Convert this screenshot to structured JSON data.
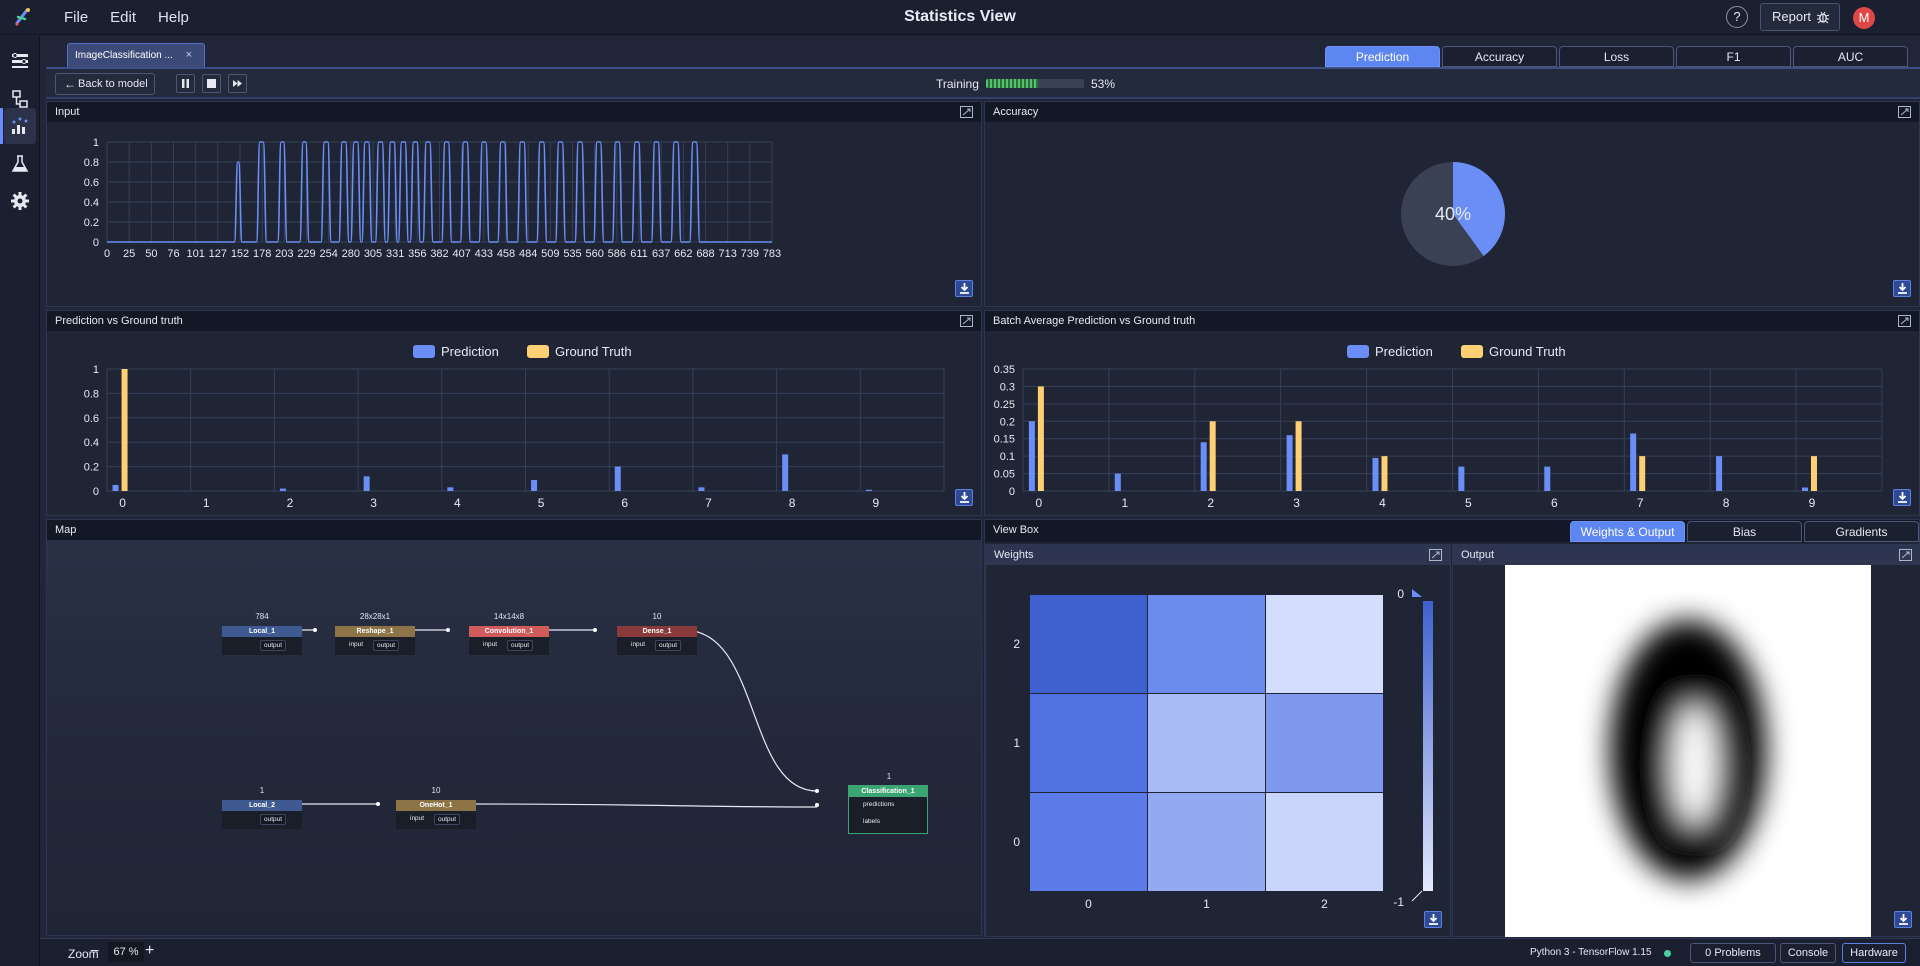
{
  "app": {
    "title": "Statistics View",
    "menu": [
      "File",
      "Edit",
      "Help"
    ],
    "help_label": "?",
    "report_label": "Report",
    "avatar_initial": "M"
  },
  "sidebar": {
    "items": [
      {
        "icon": "layers-icon",
        "active": false
      },
      {
        "icon": "model-graph-icon",
        "active": false
      },
      {
        "icon": "statistics-icon",
        "active": true
      },
      {
        "icon": "flask-icon",
        "active": false
      },
      {
        "icon": "gear-icon",
        "active": false
      }
    ]
  },
  "file_tab": {
    "label": "ImageClassification ...",
    "close": "×"
  },
  "metric_tabs": [
    {
      "label": "Prediction",
      "active": true
    },
    {
      "label": "Accuracy",
      "active": false
    },
    {
      "label": "Loss",
      "active": false
    },
    {
      "label": "F1",
      "active": false
    },
    {
      "label": "AUC",
      "active": false
    }
  ],
  "toolbar": {
    "back_label": "Back to model",
    "training_label": "Training",
    "training_progress": 0.53,
    "training_pct": "53%"
  },
  "panels": {
    "input": "Input",
    "accuracy": "Accuracy",
    "pred_vs_gt": "Prediction vs Ground truth",
    "batch_avg": "Batch Average Prediction vs Ground truth",
    "map": "Map",
    "view_box": "View Box",
    "weights": "Weights",
    "output": "Output"
  },
  "viewbox_tabs": [
    {
      "label": "Weights & Output",
      "active": true
    },
    {
      "label": "Bias",
      "active": false
    },
    {
      "label": "Gradients",
      "active": false
    }
  ],
  "chart_data": [
    {
      "id": "input",
      "type": "line",
      "x_tick_labels": [
        "0",
        "25",
        "50",
        "76",
        "101",
        "127",
        "152",
        "178",
        "203",
        "229",
        "254",
        "280",
        "305",
        "331",
        "356",
        "382",
        "407",
        "433",
        "458",
        "484",
        "509",
        "535",
        "560",
        "586",
        "611",
        "637",
        "662",
        "688",
        "713",
        "739",
        "783"
      ],
      "xlim": [
        0,
        783
      ],
      "ylim": [
        0,
        1
      ],
      "y_ticks": [
        "0",
        "0.2",
        "0.4",
        "0.6",
        "0.8",
        "1"
      ],
      "pulses": [
        [
          152,
          157,
          0.8
        ],
        [
          178,
          186,
          1
        ],
        [
          203,
          210,
          1
        ],
        [
          229,
          236,
          1
        ],
        [
          254,
          262,
          1
        ],
        [
          275,
          283,
          1
        ],
        [
          289,
          297,
          1
        ],
        [
          302,
          310,
          1
        ],
        [
          318,
          326,
          1
        ],
        [
          332,
          340,
          1
        ],
        [
          345,
          353,
          1
        ],
        [
          359,
          367,
          1
        ],
        [
          374,
          382,
          1
        ],
        [
          396,
          404,
          1
        ],
        [
          418,
          426,
          1
        ],
        [
          440,
          448,
          1
        ],
        [
          462,
          470,
          1
        ],
        [
          485,
          493,
          1
        ],
        [
          508,
          516,
          1
        ],
        [
          530,
          538,
          1
        ],
        [
          553,
          561,
          1
        ],
        [
          575,
          583,
          1
        ],
        [
          597,
          605,
          1
        ],
        [
          620,
          628,
          1
        ],
        [
          643,
          651,
          1
        ],
        [
          666,
          674,
          1
        ],
        [
          688,
          696,
          1
        ]
      ],
      "color": "#6a8ef5",
      "grid": true
    },
    {
      "id": "accuracy",
      "type": "pie",
      "values": [
        40,
        60
      ],
      "center_label": "40%",
      "colors": [
        "#6a8ef5",
        "#3a4154"
      ]
    },
    {
      "id": "pred_vs_gt",
      "type": "bar",
      "categories": [
        "0",
        "1",
        "2",
        "3",
        "4",
        "5",
        "6",
        "7",
        "8",
        "9"
      ],
      "series": [
        {
          "name": "Prediction",
          "values": [
            0.05,
            0,
            0.02,
            0.12,
            0.03,
            0.09,
            0.2,
            0.03,
            0.3,
            0.01
          ],
          "color": "#6a8ef5"
        },
        {
          "name": "Ground Truth",
          "values": [
            1,
            0,
            0,
            0,
            0,
            0,
            0,
            0,
            0,
            0
          ],
          "color": "#ffcf73"
        }
      ],
      "ylim": [
        0,
        1
      ],
      "y_ticks": [
        "0",
        "0.2",
        "0.4",
        "0.6",
        "0.8",
        "1"
      ],
      "legend": "top-center",
      "grid": true
    },
    {
      "id": "batch_avg",
      "type": "bar",
      "categories": [
        "0",
        "1",
        "2",
        "3",
        "4",
        "5",
        "6",
        "7",
        "8",
        "9"
      ],
      "series": [
        {
          "name": "Prediction",
          "values": [
            0.2,
            0.05,
            0.14,
            0.16,
            0.095,
            0.07,
            0.07,
            0.165,
            0.1,
            0.01
          ],
          "color": "#6a8ef5"
        },
        {
          "name": "Ground Truth",
          "values": [
            0.3,
            0,
            0.2,
            0.2,
            0.1,
            0,
            0,
            0.1,
            0,
            0.1
          ],
          "color": "#ffcf73"
        }
      ],
      "ylim": [
        0,
        0.35
      ],
      "y_ticks": [
        "0",
        "0.05",
        "0.1",
        "0.15",
        "0.2",
        "0.25",
        "0.3",
        "0.35"
      ],
      "legend": "top-center",
      "grid": true
    },
    {
      "id": "weights",
      "type": "heatmap",
      "x_labels": [
        "0",
        "1",
        "2"
      ],
      "y_labels": [
        "0",
        "1",
        "2"
      ],
      "cells": [
        [
          "#5b7be8",
          "#93aaf2",
          "#c9d5fa"
        ],
        [
          "#4f71e2",
          "#a9bbf4",
          "#7d98ee"
        ],
        [
          "#3f61cf",
          "#6c8bee",
          "#d4ddfb"
        ]
      ],
      "scale_max": "0",
      "scale_min": "-1"
    }
  ],
  "map": {
    "nodes": [
      {
        "id": "local1",
        "dim": "784",
        "name": "Local_1",
        "color": "#3f5a91",
        "inputs": [],
        "outputs": [
          "output"
        ]
      },
      {
        "id": "reshape1",
        "dim": "28x28x1",
        "name": "Reshape_1",
        "color": "#8c7446",
        "inputs": [
          "input"
        ],
        "outputs": [
          "output"
        ]
      },
      {
        "id": "conv1",
        "dim": "14x14x8",
        "name": "Convolution_1",
        "color": "#d15a5a",
        "inputs": [
          "input"
        ],
        "outputs": [
          "output"
        ]
      },
      {
        "id": "dense1",
        "dim": "10",
        "name": "Dense_1",
        "color": "#8a3a3a",
        "inputs": [
          "input"
        ],
        "outputs": [
          "output"
        ]
      },
      {
        "id": "local2",
        "dim": "1",
        "name": "Local_2",
        "color": "#3f5a91",
        "inputs": [],
        "outputs": [
          "output"
        ]
      },
      {
        "id": "onehot1",
        "dim": "10",
        "name": "OneHot_1",
        "color": "#8c7446",
        "inputs": [
          "input"
        ],
        "outputs": [
          "output"
        ]
      },
      {
        "id": "class1",
        "dim": "1",
        "name": "Classification_1",
        "color": "#3aa472",
        "inputs": [
          "predictions",
          "labels"
        ],
        "outputs": []
      }
    ]
  },
  "statusbar": {
    "zoom_label": "Zoom",
    "zoom_minus": "−",
    "zoom_value": "67 %",
    "zoom_plus": "+",
    "environment": "Python 3 - TensorFlow 1.15",
    "problems": "0 Problems",
    "console": "Console",
    "hardware": "Hardware"
  }
}
